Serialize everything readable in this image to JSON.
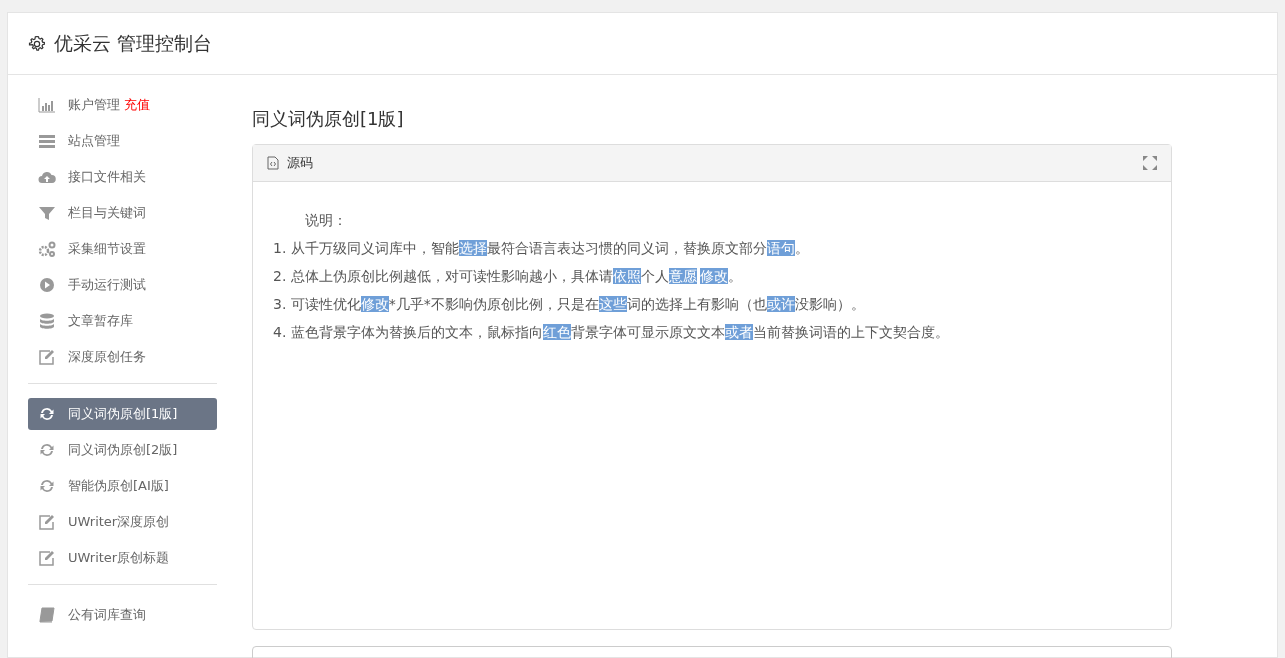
{
  "header": {
    "title": "优采云 管理控制台"
  },
  "sidebar": {
    "groups": [
      [
        {
          "label": "账户管理",
          "badge": "充值",
          "selected": false
        },
        {
          "label": "站点管理",
          "selected": false
        },
        {
          "label": "接口文件相关",
          "selected": false
        },
        {
          "label": "栏目与关键词",
          "selected": false
        },
        {
          "label": "采集细节设置",
          "selected": false
        },
        {
          "label": "手动运行测试",
          "selected": false
        },
        {
          "label": "文章暂存库",
          "selected": false
        },
        {
          "label": "深度原创任务",
          "selected": false
        }
      ],
      [
        {
          "label": "同义词伪原创[1版]",
          "selected": true
        },
        {
          "label": "同义词伪原创[2版]",
          "selected": false
        },
        {
          "label": "智能伪原创[AI版]",
          "selected": false
        },
        {
          "label": "UWriter深度原创",
          "selected": false
        },
        {
          "label": "UWriter原创标题",
          "selected": false
        }
      ],
      [
        {
          "label": "公有词库查询",
          "selected": false
        }
      ]
    ]
  },
  "main": {
    "heading": "同义词伪原创[1版]",
    "editor": {
      "tab": "源码",
      "intro": "说明：",
      "lines": [
        [
          {
            "text": "1. 从千万级同义词库中，智能",
            "hl": false
          },
          {
            "text": "选择",
            "hl": true
          },
          {
            "text": "最符合语言表达习惯的同义词，替换原文部分",
            "hl": false
          },
          {
            "text": "语句",
            "hl": true
          },
          {
            "text": "。",
            "hl": false
          }
        ],
        [
          {
            "text": "2. 总体上伪原创比例越低，对可读性影响越小，具体请",
            "hl": false
          },
          {
            "text": "依照",
            "hl": true
          },
          {
            "text": "个人",
            "hl": false
          },
          {
            "text": "意愿",
            "hl": true
          },
          {
            "text": "修改",
            "hl": true
          },
          {
            "text": "。",
            "hl": false
          }
        ],
        [
          {
            "text": "3. 可读性优化",
            "hl": false
          },
          {
            "text": "修改",
            "hl": true
          },
          {
            "text": "*几乎*不影响伪原创比例，只是在",
            "hl": false
          },
          {
            "text": "这些",
            "hl": true
          },
          {
            "text": "词的选择上有影响（也",
            "hl": false
          },
          {
            "text": "或许",
            "hl": true
          },
          {
            "text": "没影响）。",
            "hl": false
          }
        ],
        [
          {
            "text": "4. 蓝色背景字体为替换后的文本，鼠标指向",
            "hl": false
          },
          {
            "text": "红色",
            "hl": true
          },
          {
            "text": "背景字体可显示原文文本",
            "hl": false
          },
          {
            "text": "或者",
            "hl": true
          },
          {
            "text": "当前替换词语的上下文契合度。",
            "hl": false
          }
        ]
      ]
    }
  }
}
